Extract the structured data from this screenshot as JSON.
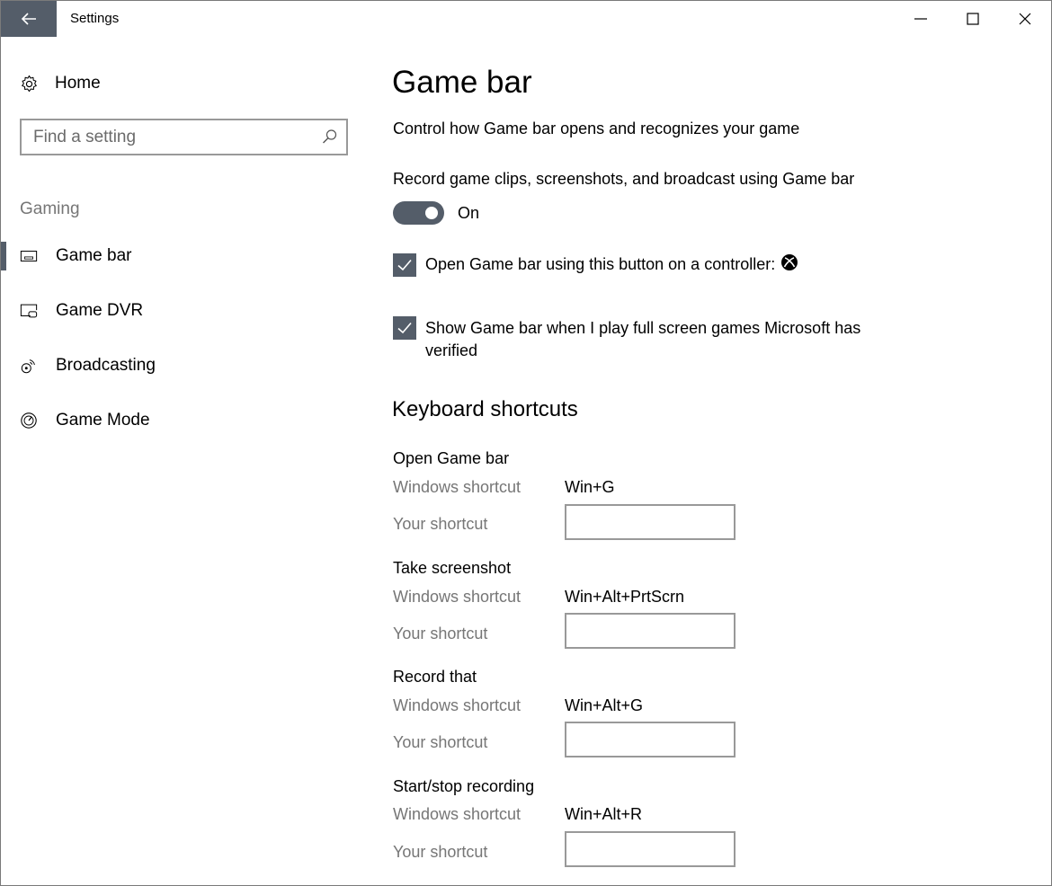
{
  "window": {
    "title": "Settings"
  },
  "sidebar": {
    "home_label": "Home",
    "search_placeholder": "Find a setting",
    "section_label": "Gaming",
    "items": [
      {
        "label": "Game bar",
        "icon": "gamebar-icon",
        "active": true
      },
      {
        "label": "Game DVR",
        "icon": "game-dvr-icon",
        "active": false
      },
      {
        "label": "Broadcasting",
        "icon": "broadcast-icon",
        "active": false
      },
      {
        "label": "Game Mode",
        "icon": "gauge-icon",
        "active": false
      }
    ]
  },
  "main": {
    "title": "Game bar",
    "description": "Control how Game bar opens and recognizes your game",
    "record_setting": {
      "label": "Record game clips, screenshots, and broadcast using Game bar",
      "state": "On",
      "enabled": true
    },
    "checkboxes": [
      {
        "label": "Open Game bar using this button on a controller:",
        "checked": true,
        "trailing_icon": "xbox-icon"
      },
      {
        "label_line1": "Show Game bar when I play full screen games Microsoft has",
        "label_line2": "verified",
        "checked": true
      }
    ],
    "keyboard_shortcuts": {
      "title": "Keyboard shortcuts",
      "windows_shortcut_label": "Windows shortcut",
      "your_shortcut_label": "Your shortcut",
      "groups": [
        {
          "title": "Open Game bar",
          "windows_shortcut": "Win+G",
          "your_shortcut": ""
        },
        {
          "title": "Take screenshot",
          "windows_shortcut": "Win+Alt+PrtScrn",
          "your_shortcut": ""
        },
        {
          "title": "Record that",
          "windows_shortcut": "Win+Alt+G",
          "your_shortcut": ""
        },
        {
          "title": "Start/stop recording",
          "windows_shortcut": "Win+Alt+R",
          "your_shortcut": ""
        }
      ]
    }
  },
  "colors": {
    "accent": "#545d69",
    "secondary_text": "#767676",
    "input_border": "#999999"
  }
}
